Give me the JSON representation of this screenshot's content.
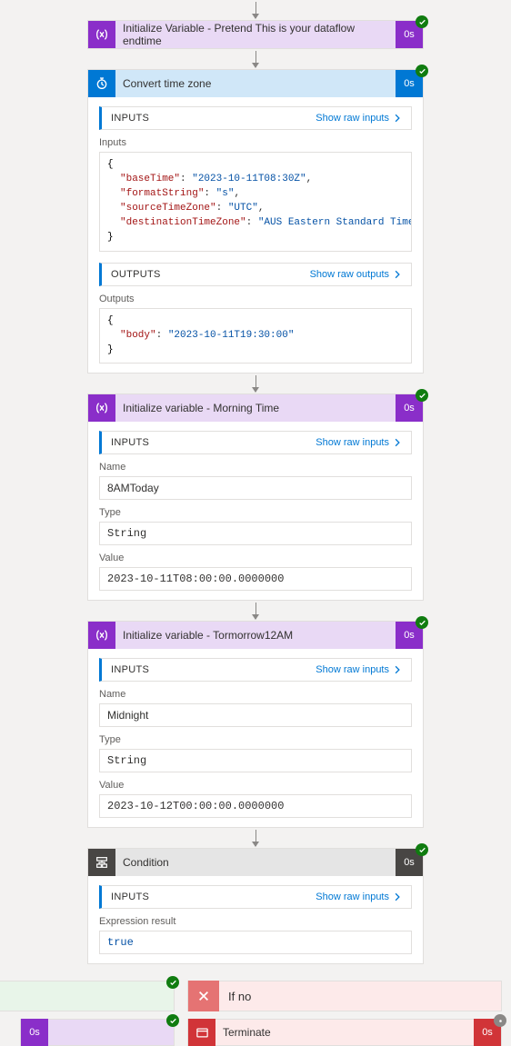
{
  "dur": "0s",
  "labels": {
    "inputs_bar": "INPUTS",
    "outputs_bar": "OUTPUTS",
    "show_raw_inputs": "Show raw inputs",
    "show_raw_outputs": "Show raw outputs",
    "inputs_heading": "Inputs",
    "outputs_heading": "Outputs",
    "name": "Name",
    "type": "Type",
    "value": "Value",
    "expr_result": "Expression result",
    "if_no": "If no",
    "terminate": "Terminate"
  },
  "step1": {
    "title": "Initialize Variable - Pretend This is your dataflow endtime"
  },
  "step2": {
    "title": "Convert time zone",
    "inputs": {
      "baseTime_k": "\"baseTime\"",
      "baseTime_v": "\"2023-10-11T08:30Z\"",
      "formatString_k": "\"formatString\"",
      "formatString_v": "\"s\"",
      "sourceTZ_k": "\"sourceTimeZone\"",
      "sourceTZ_v": "\"UTC\"",
      "destTZ_k": "\"destinationTimeZone\"",
      "destTZ_v": "\"AUS Eastern Standard Time\""
    },
    "outputs": {
      "body_k": "\"body\"",
      "body_v": "\"2023-10-11T19:30:00\""
    }
  },
  "step3": {
    "title": "Initialize variable - Morning Time",
    "name": "8AMToday",
    "type": "String",
    "value": "2023-10-11T08:00:00.0000000"
  },
  "step4": {
    "title": "Initialize variable - Tormorrow12AM",
    "name": "Midnight",
    "type": "String",
    "value": "2023-10-12T00:00:00.0000000"
  },
  "step5": {
    "title": "Condition",
    "result": "true"
  },
  "chart_data": null
}
